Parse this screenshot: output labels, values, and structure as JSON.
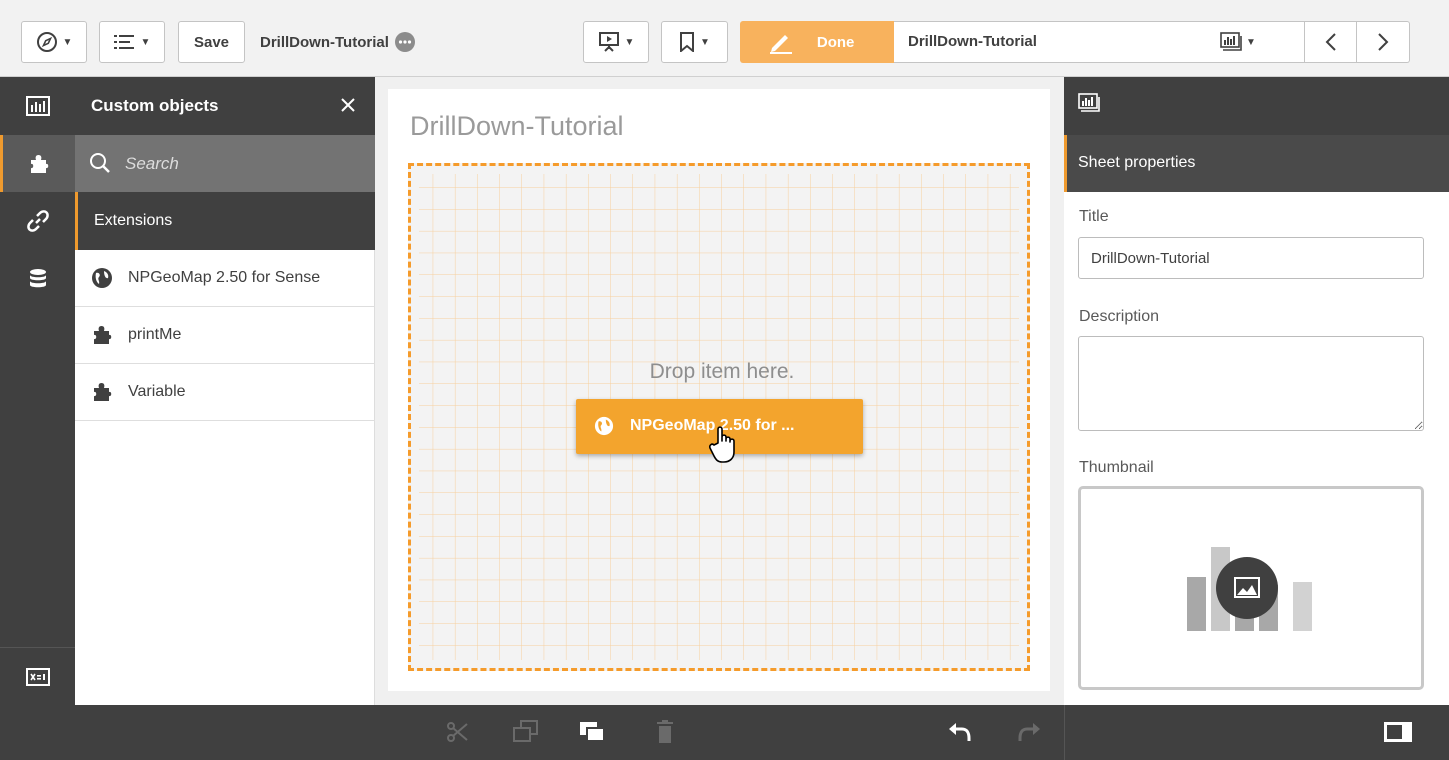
{
  "toolbar": {
    "save_label": "Save",
    "app_title": "DrillDown-Tutorial",
    "done_label": "Done",
    "sheet_title": "DrillDown-Tutorial"
  },
  "panel": {
    "title": "Custom objects",
    "search_placeholder": "Search",
    "section_title": "Extensions",
    "items": [
      {
        "label": "NPGeoMap 2.50 for Sense",
        "icon": "globe-icon"
      },
      {
        "label": "printMe",
        "icon": "puzzle-icon"
      },
      {
        "label": "Variable",
        "icon": "puzzle-icon"
      }
    ]
  },
  "sheet": {
    "title": "DrillDown-Tutorial",
    "drop_text": "Drop item here.",
    "drag_item_label": "NPGeoMap 2.50 for ..."
  },
  "properties": {
    "header": "Sheet properties",
    "title_label": "Title",
    "title_value": "DrillDown-Tutorial",
    "description_label": "Description",
    "description_value": "",
    "thumbnail_label": "Thumbnail"
  },
  "colors": {
    "accent": "#f8b25d",
    "drag": "#f3a42d",
    "dark": "#404040"
  }
}
